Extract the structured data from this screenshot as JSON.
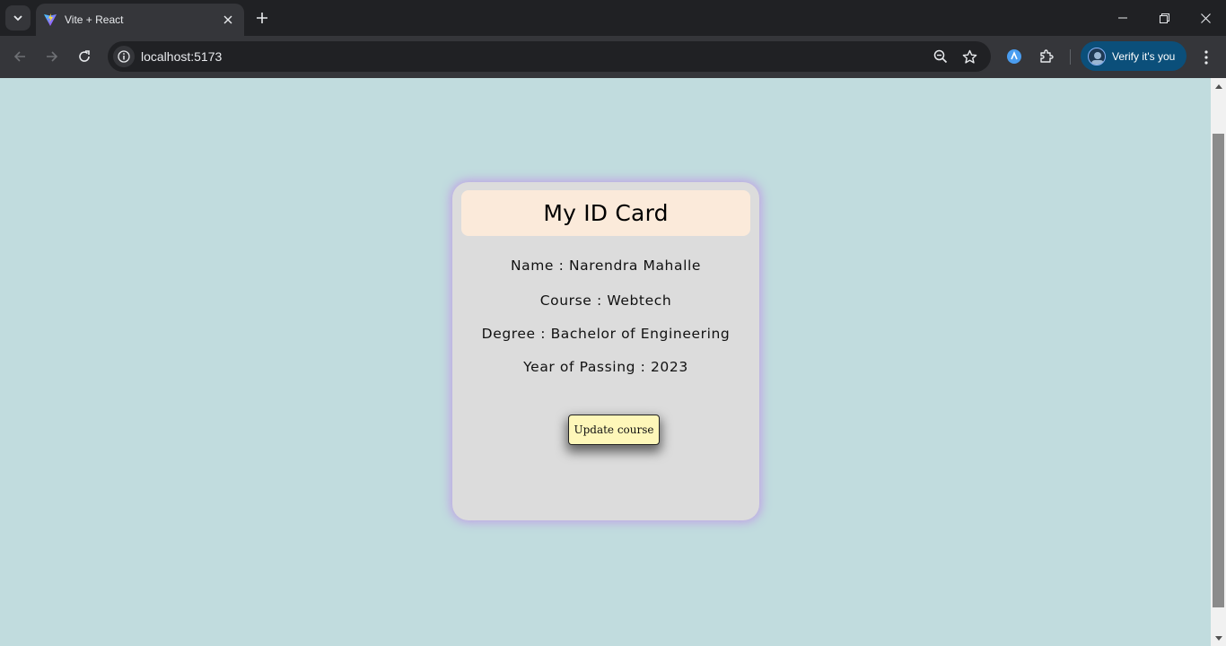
{
  "browser": {
    "tab": {
      "title": "Vite + React"
    },
    "address_bar": {
      "url": "localhost:5173"
    },
    "profile": {
      "label": "Verify it's you"
    }
  },
  "colors": {
    "page_background": "#c1dcde",
    "card_background": "#dcdcdc",
    "card_header_background": "#fbeada",
    "card_glow": "#be96e6",
    "button_background": "#fef7b9",
    "profile_pill": "#0b4f7a"
  },
  "card": {
    "title": "My ID Card",
    "fields": [
      {
        "label": "Name",
        "separator": " : ",
        "value": "Narendra Mahalle"
      },
      {
        "label": "Course",
        "separator": " : ",
        "value": "Webtech"
      },
      {
        "label": "Degree",
        "separator": " : ",
        "value": "Bachelor of Engineering"
      },
      {
        "label": "Year of Passing",
        "separator": " : ",
        "value": "2023"
      }
    ],
    "button_label": "Update course"
  },
  "icons": {
    "tab_search": "chevron-down-icon",
    "favicon": "vite-logo-icon",
    "tab_close": "close-icon",
    "new_tab": "plus-icon",
    "back": "arrow-left-icon",
    "forward": "arrow-right-icon",
    "reload": "reload-icon",
    "site_info": "info-icon",
    "zoom": "zoom-out-icon",
    "bookmark": "star-icon",
    "extension_1": "extension-blue-icon",
    "extensions": "puzzle-icon",
    "menu": "kebab-menu-icon"
  }
}
